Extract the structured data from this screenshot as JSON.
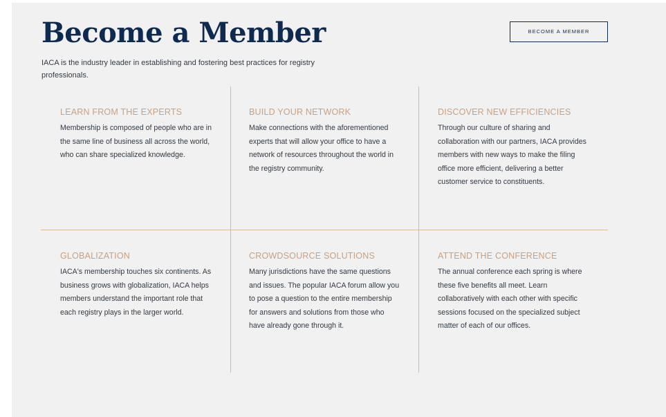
{
  "header": {
    "title": "Become a Member",
    "intro": "IACA is the industry leader in establishing and fostering best practices for registry professionals.",
    "cta_label": "BECOME A MEMBER"
  },
  "colors": {
    "title": "#0f2a4f",
    "accent": "#cc9f7c",
    "divider": "#d8b99a",
    "panel_background": "#f1f1f1",
    "body_text": "#333a44"
  },
  "benefits": [
    {
      "title": "LEARN FROM THE EXPERTS",
      "body": "Membership is composed of people who are in the same line of business all across the world, who can share specialized knowledge."
    },
    {
      "title": "BUILD YOUR NETWORK",
      "body": "Make connections with the aforementioned experts that will allow your office to have a network of resources throughout the world in the registry community."
    },
    {
      "title": "DISCOVER NEW EFFICIENCIES",
      "body": "Through our culture of sharing and collaboration with our partners, IACA provides members with new ways to make the filing office more efficient, delivering a better customer service to constituents."
    },
    {
      "title": "GLOBALIZATION",
      "body": "IACA's membership touches six continents. As business grows with globalization, IACA helps members understand the important role that each registry plays in the larger world."
    },
    {
      "title": "CROWDSOURCE SOLUTIONS",
      "body": "Many jurisdictions have the same questions and issues. The popular IACA forum allow you to pose a question to the entire membership for answers and solutions from those who have already gone through it."
    },
    {
      "title": "ATTEND THE CONFERENCE",
      "body": "The annual conference each spring is where these five benefits all meet. Learn collaboratively with each other with specific sessions focused on the specialized subject matter of each of our offices."
    }
  ]
}
